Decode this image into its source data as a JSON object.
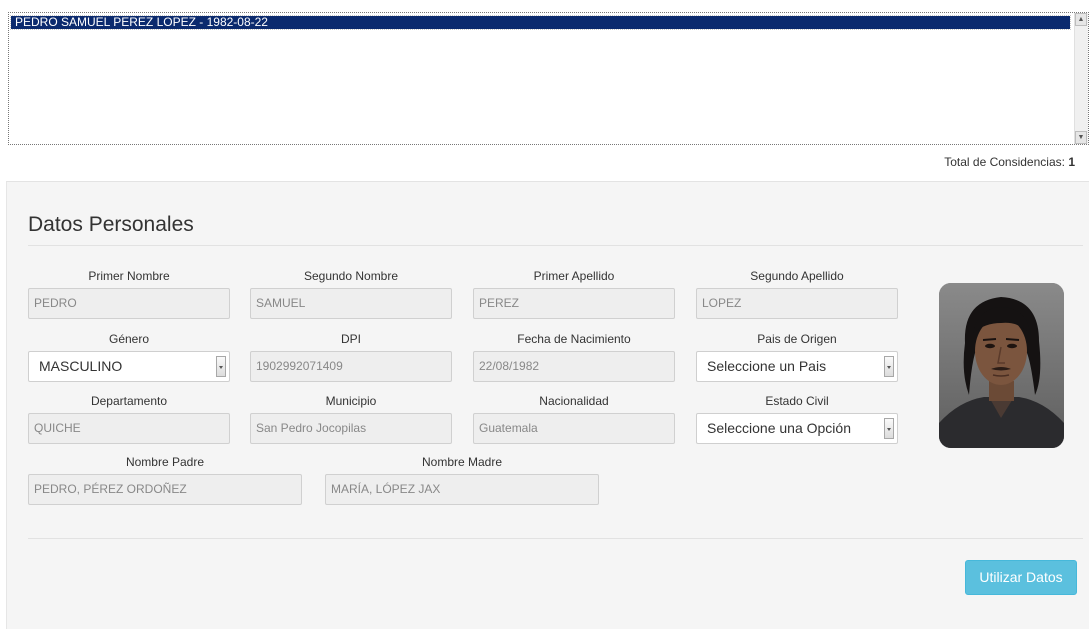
{
  "results": {
    "items": [
      "PEDRO SAMUEL PEREZ LOPEZ - 1982-08-22"
    ],
    "total_label": "Total de Considencias:",
    "total_value": "1"
  },
  "panel": {
    "title": "Datos Personales",
    "fields": {
      "primer_nombre": {
        "label": "Primer Nombre",
        "value": "PEDRO"
      },
      "segundo_nombre": {
        "label": "Segundo Nombre",
        "value": "SAMUEL"
      },
      "primer_apellido": {
        "label": "Primer Apellido",
        "value": "PEREZ"
      },
      "segundo_apellido": {
        "label": "Segundo Apellido",
        "value": "LOPEZ"
      },
      "genero": {
        "label": "Género",
        "value": "MASCULINO"
      },
      "dpi": {
        "label": "DPI",
        "value": "1902992071409"
      },
      "fecha_nacimiento": {
        "label": "Fecha de Nacimiento",
        "value": "22/08/1982"
      },
      "pais_origen": {
        "label": "Pais de Origen",
        "value": "Seleccione un Pais"
      },
      "departamento": {
        "label": "Departamento",
        "value": "QUICHE"
      },
      "municipio": {
        "label": "Municipio",
        "value": "San Pedro Jocopilas"
      },
      "nacionalidad": {
        "label": "Nacionalidad",
        "value": "Guatemala"
      },
      "estado_civil": {
        "label": "Estado Civil",
        "value": "Seleccione una Opción"
      },
      "nombre_padre": {
        "label": "Nombre Padre",
        "value": "PEDRO, PÉREZ ORDOÑEZ"
      },
      "nombre_madre": {
        "label": "Nombre Madre",
        "value": "MARÍA, LÓPEZ JAX"
      }
    },
    "submit_label": "Utilizar Datos"
  },
  "colors": {
    "accent": "#5bc0de",
    "selection": "#0b2a6e",
    "panel_bg": "#f5f5f5"
  }
}
